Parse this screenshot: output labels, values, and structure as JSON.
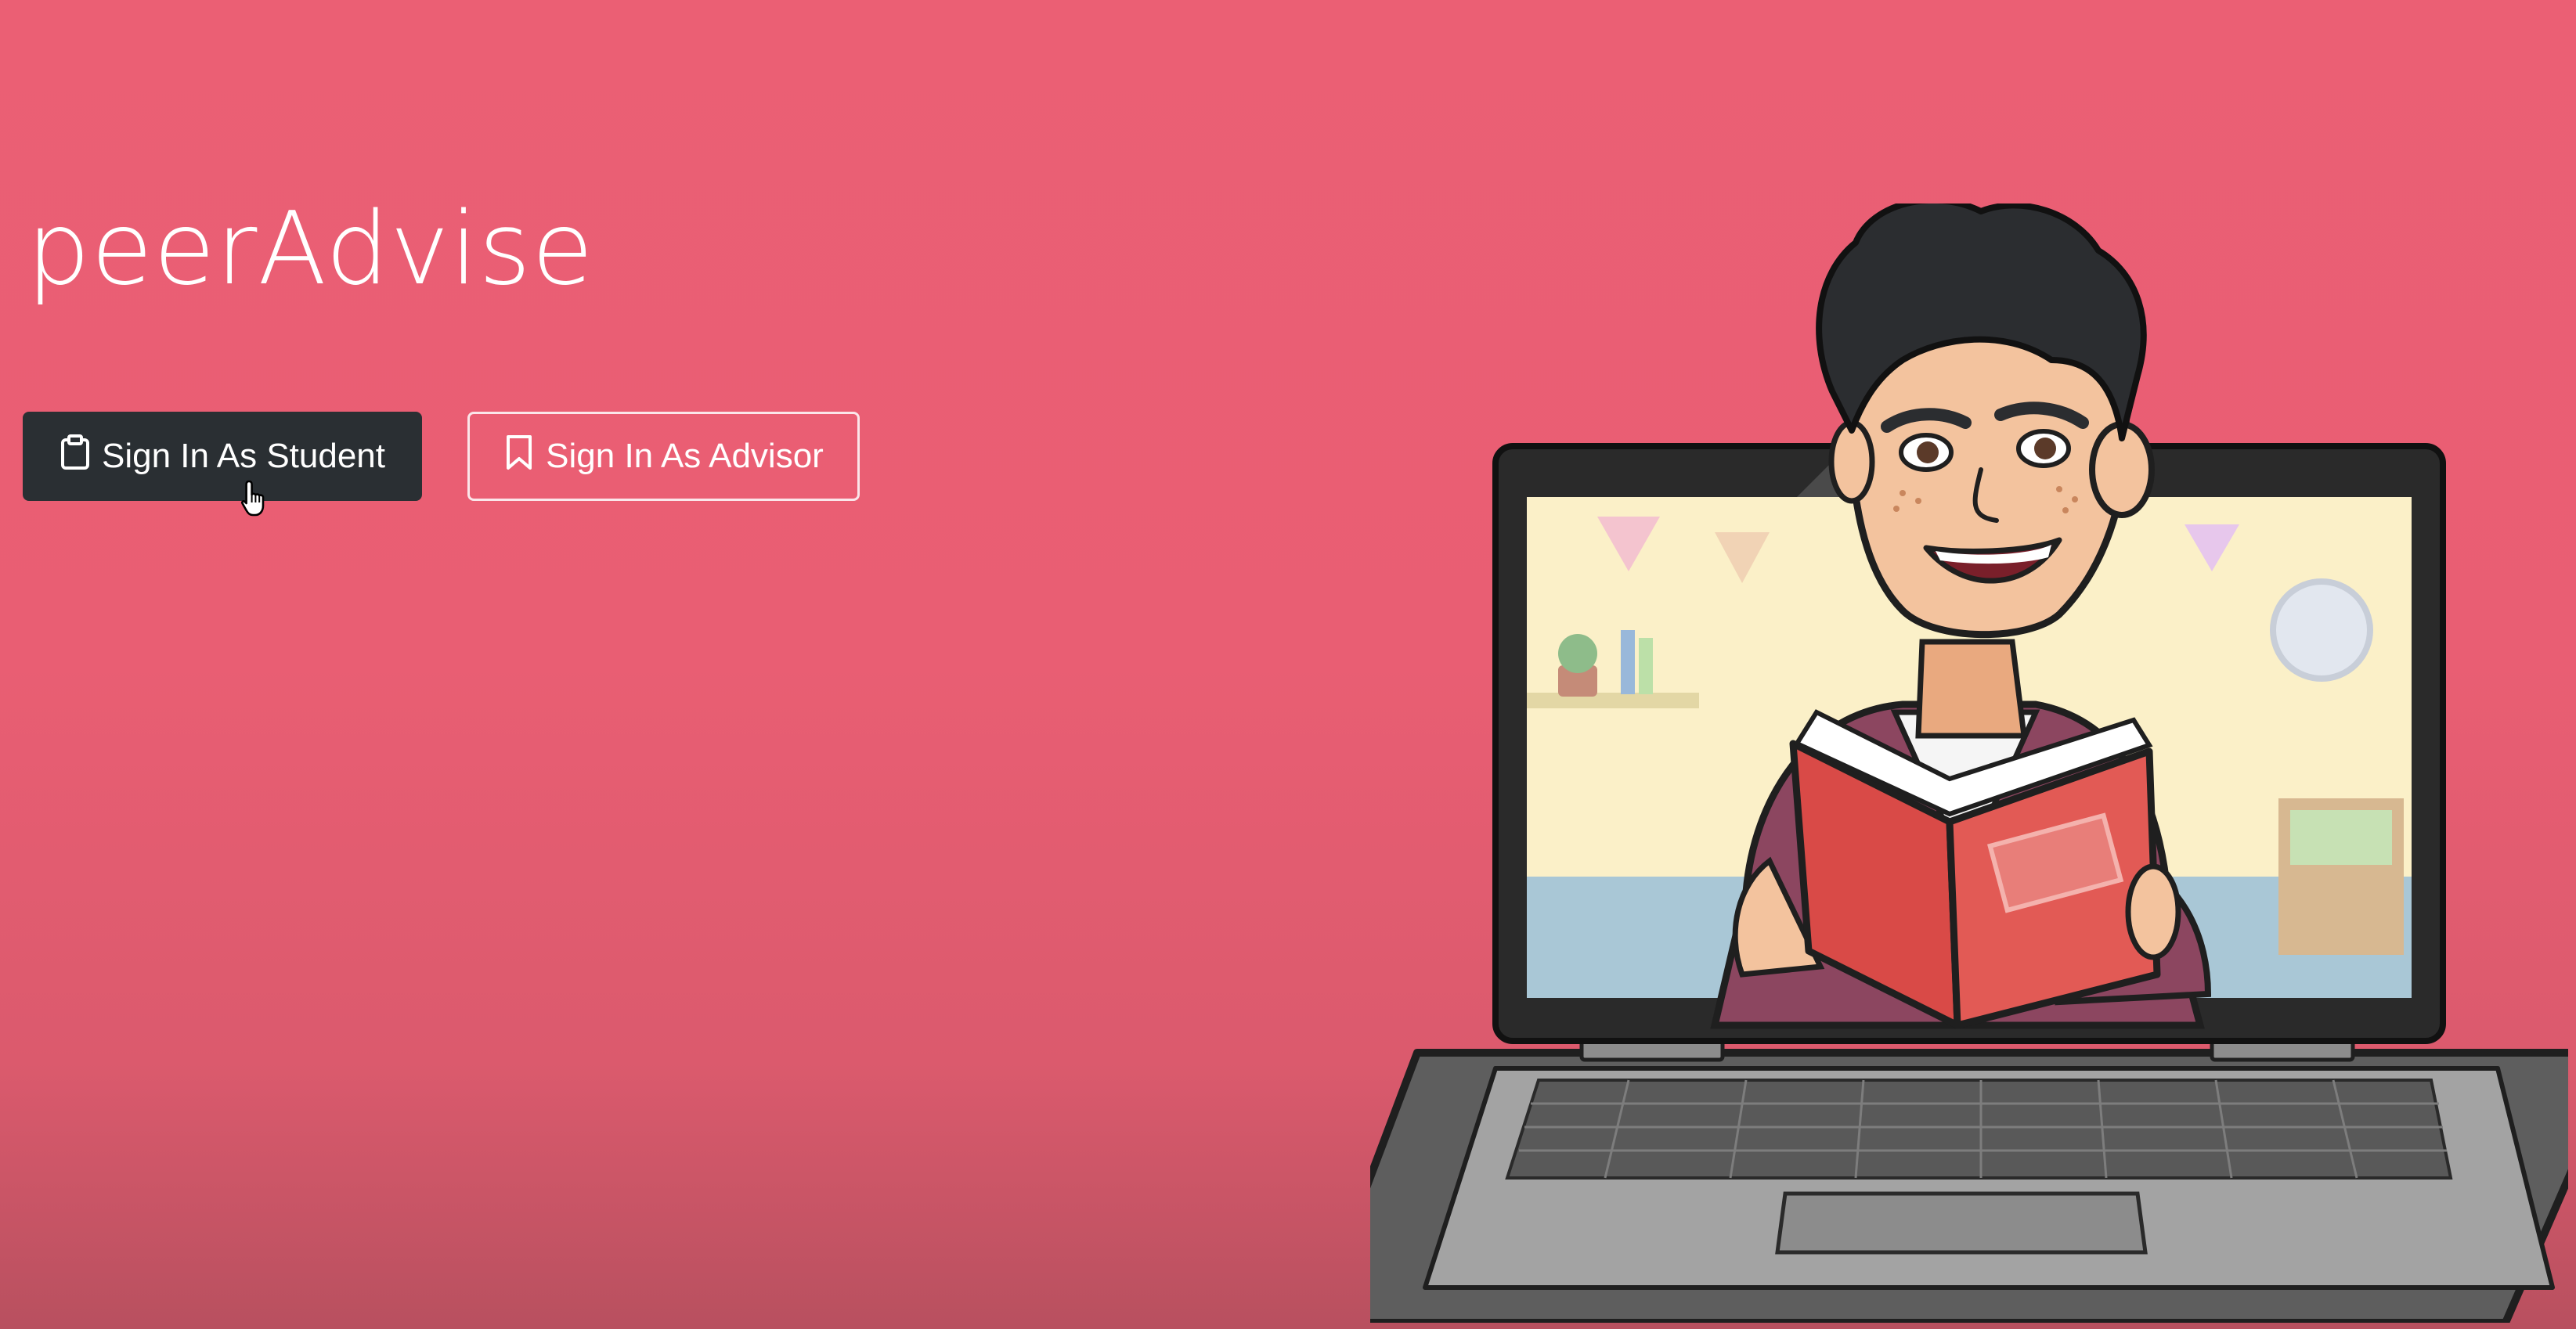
{
  "app": {
    "brand": "peerAdvise"
  },
  "actions": {
    "student": {
      "label": "Sign In As Student",
      "icon": "clipboard-icon"
    },
    "advisor": {
      "label": "Sign In As Advisor",
      "icon": "bookmark-icon"
    }
  },
  "colors": {
    "background": "#eb5f74",
    "student_button": "#2a2f33",
    "advisor_border": "#fbe6ea",
    "text": "#ffffff"
  }
}
